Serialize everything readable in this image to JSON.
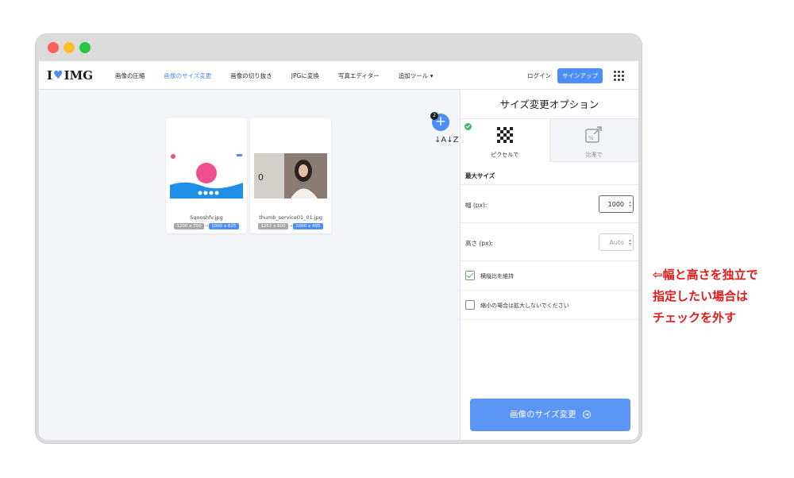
{
  "nav": {
    "logo_left": "I",
    "logo_right": "IMG",
    "items": [
      {
        "label": "画像の圧縮",
        "active": false
      },
      {
        "label": "画像のサイズ変更",
        "active": true
      },
      {
        "label": "画像の切り抜き",
        "active": false
      },
      {
        "label": "JPGに変換",
        "active": false
      },
      {
        "label": "写真エディター",
        "active": false
      },
      {
        "label": "追加ツール ▾",
        "active": false
      }
    ],
    "login": "ログイン",
    "signup": "サインアップ"
  },
  "files": [
    {
      "name": "Sqooshfv.jpg",
      "original": "1200 x 750",
      "resized": "1000 x 625"
    },
    {
      "name": "thumb_service01_01.jpg",
      "original": "1252 x 600",
      "resized": "1000 x 495"
    }
  ],
  "toolbar": {
    "add_count": "2",
    "add_label": "+",
    "sort_label": "↓A↓Z"
  },
  "panel": {
    "title": "サイズ変更オプション",
    "tab_pixels": "ピクセルで",
    "tab_percent": "比率で",
    "section_title": "最大サイズ",
    "width_label": "幅 (px):",
    "width_value": "1000",
    "height_label": "高さ (px):",
    "height_placeholder": "Auto",
    "keep_ratio_label": "横縦比を維持",
    "keep_ratio_checked": true,
    "no_enlarge_label": "縮小の場合は拡大しないでください",
    "no_enlarge_checked": false,
    "submit": "画像のサイズ変更"
  },
  "annotation": {
    "line1": "⇦幅と高さを独立で",
    "line2": "指定したい場合は",
    "line3": "チェックを外す"
  },
  "colors": {
    "accent": "#4d8df7",
    "annotation": "#e11a1a",
    "check": "#46b86a"
  }
}
